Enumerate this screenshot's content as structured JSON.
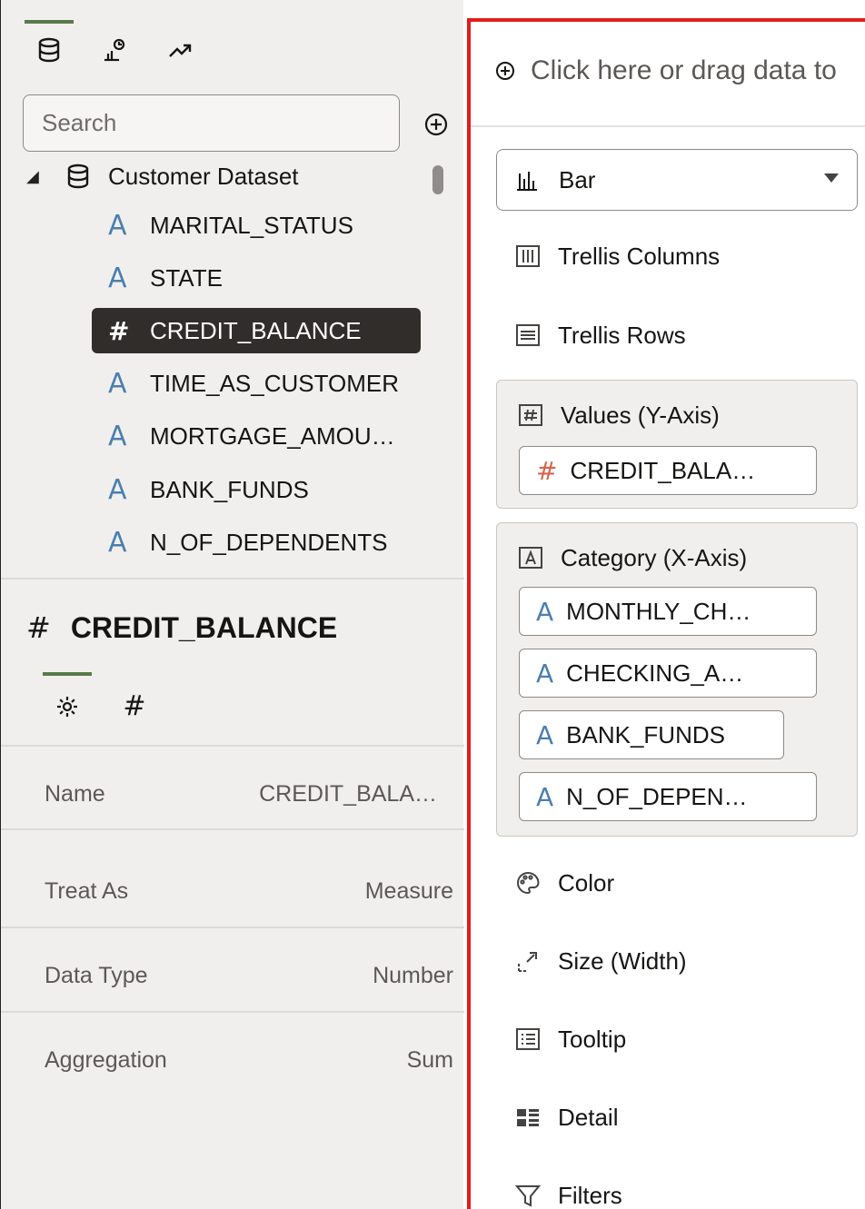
{
  "data_panel": {
    "tabs": [
      {
        "name": "data-icon",
        "active": true
      },
      {
        "name": "analytics-icon",
        "active": false
      },
      {
        "name": "trend-icon",
        "active": false
      }
    ],
    "search": {
      "placeholder": "Search"
    },
    "dataset": {
      "name": "Customer Dataset",
      "columns": [
        {
          "label": "MARITAL_STATUS",
          "type": "attribute",
          "glyph": "A"
        },
        {
          "label": "STATE",
          "type": "attribute",
          "glyph": "A"
        },
        {
          "label": "CREDIT_BALANCE",
          "type": "measure",
          "glyph": "#",
          "selected": true
        },
        {
          "label": "TIME_AS_CUSTOMER",
          "type": "attribute",
          "glyph": "A"
        },
        {
          "label": "MORTGAGE_AMOU…",
          "type": "attribute",
          "glyph": "A"
        },
        {
          "label": "BANK_FUNDS",
          "type": "attribute",
          "glyph": "A"
        },
        {
          "label": "N_OF_DEPENDENTS",
          "type": "attribute",
          "glyph": "A"
        }
      ]
    }
  },
  "properties": {
    "hash": "#",
    "title": "CREDIT_BALANCE",
    "tabs": [
      {
        "name": "gear-icon",
        "active": true
      },
      {
        "name": "hash-icon",
        "active": false
      }
    ],
    "hash_tab_glyph": "#",
    "rows": [
      {
        "label": "Name",
        "value": "CREDIT_BALA…"
      },
      {
        "label": "Treat As",
        "value": "Measure"
      },
      {
        "label": "Data Type",
        "value": "Number"
      },
      {
        "label": "Aggregation",
        "value": "Sum"
      }
    ]
  },
  "grammar": {
    "drop_hint": "Click here or drag data to",
    "chart_type": "Bar",
    "zones": {
      "trellis_columns": "Trellis Columns",
      "trellis_rows": "Trellis Rows",
      "values_label": "Values (Y-Axis)",
      "values_items": [
        {
          "glyph": "#",
          "label": "CREDIT_BALA…"
        }
      ],
      "category_label": "Category (X-Axis)",
      "category_items": [
        {
          "glyph": "A",
          "label": "MONTHLY_CH…"
        },
        {
          "glyph": "A",
          "label": "CHECKING_A…"
        },
        {
          "glyph": "A",
          "label": "BANK_FUNDS"
        },
        {
          "glyph": "A",
          "label": "N_OF_DEPEN…"
        }
      ],
      "color": "Color",
      "size": "Size (Width)",
      "tooltip": "Tooltip",
      "detail": "Detail",
      "filters": "Filters"
    }
  },
  "colors": {
    "accent_green": "#587a4a",
    "highlight_red": "#e11d1d",
    "measure_glyph": "#d9624a",
    "attribute_glyph": "#4a7fb0",
    "selected_bg": "#312d2a"
  }
}
